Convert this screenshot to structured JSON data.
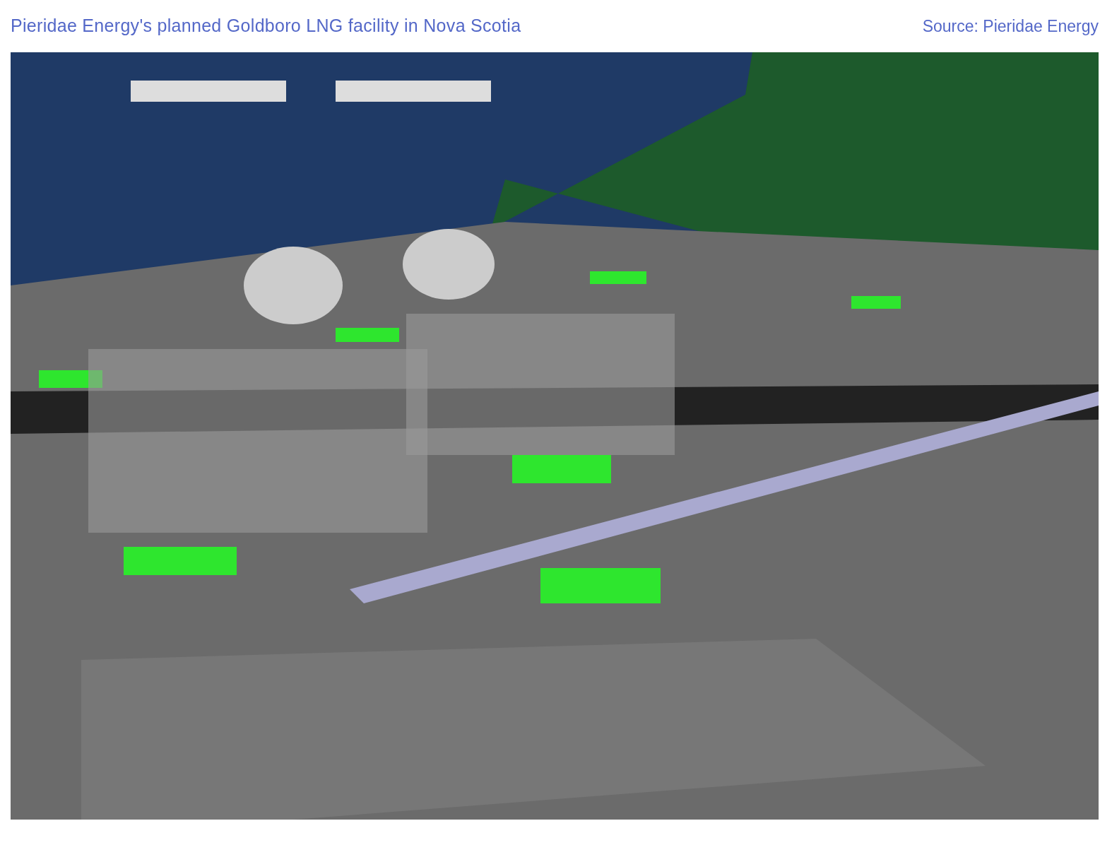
{
  "figure": {
    "title": "Pieridae Energy's planned Goldboro LNG facility in Nova Scotia",
    "source": "Source: Pieridae Energy"
  }
}
